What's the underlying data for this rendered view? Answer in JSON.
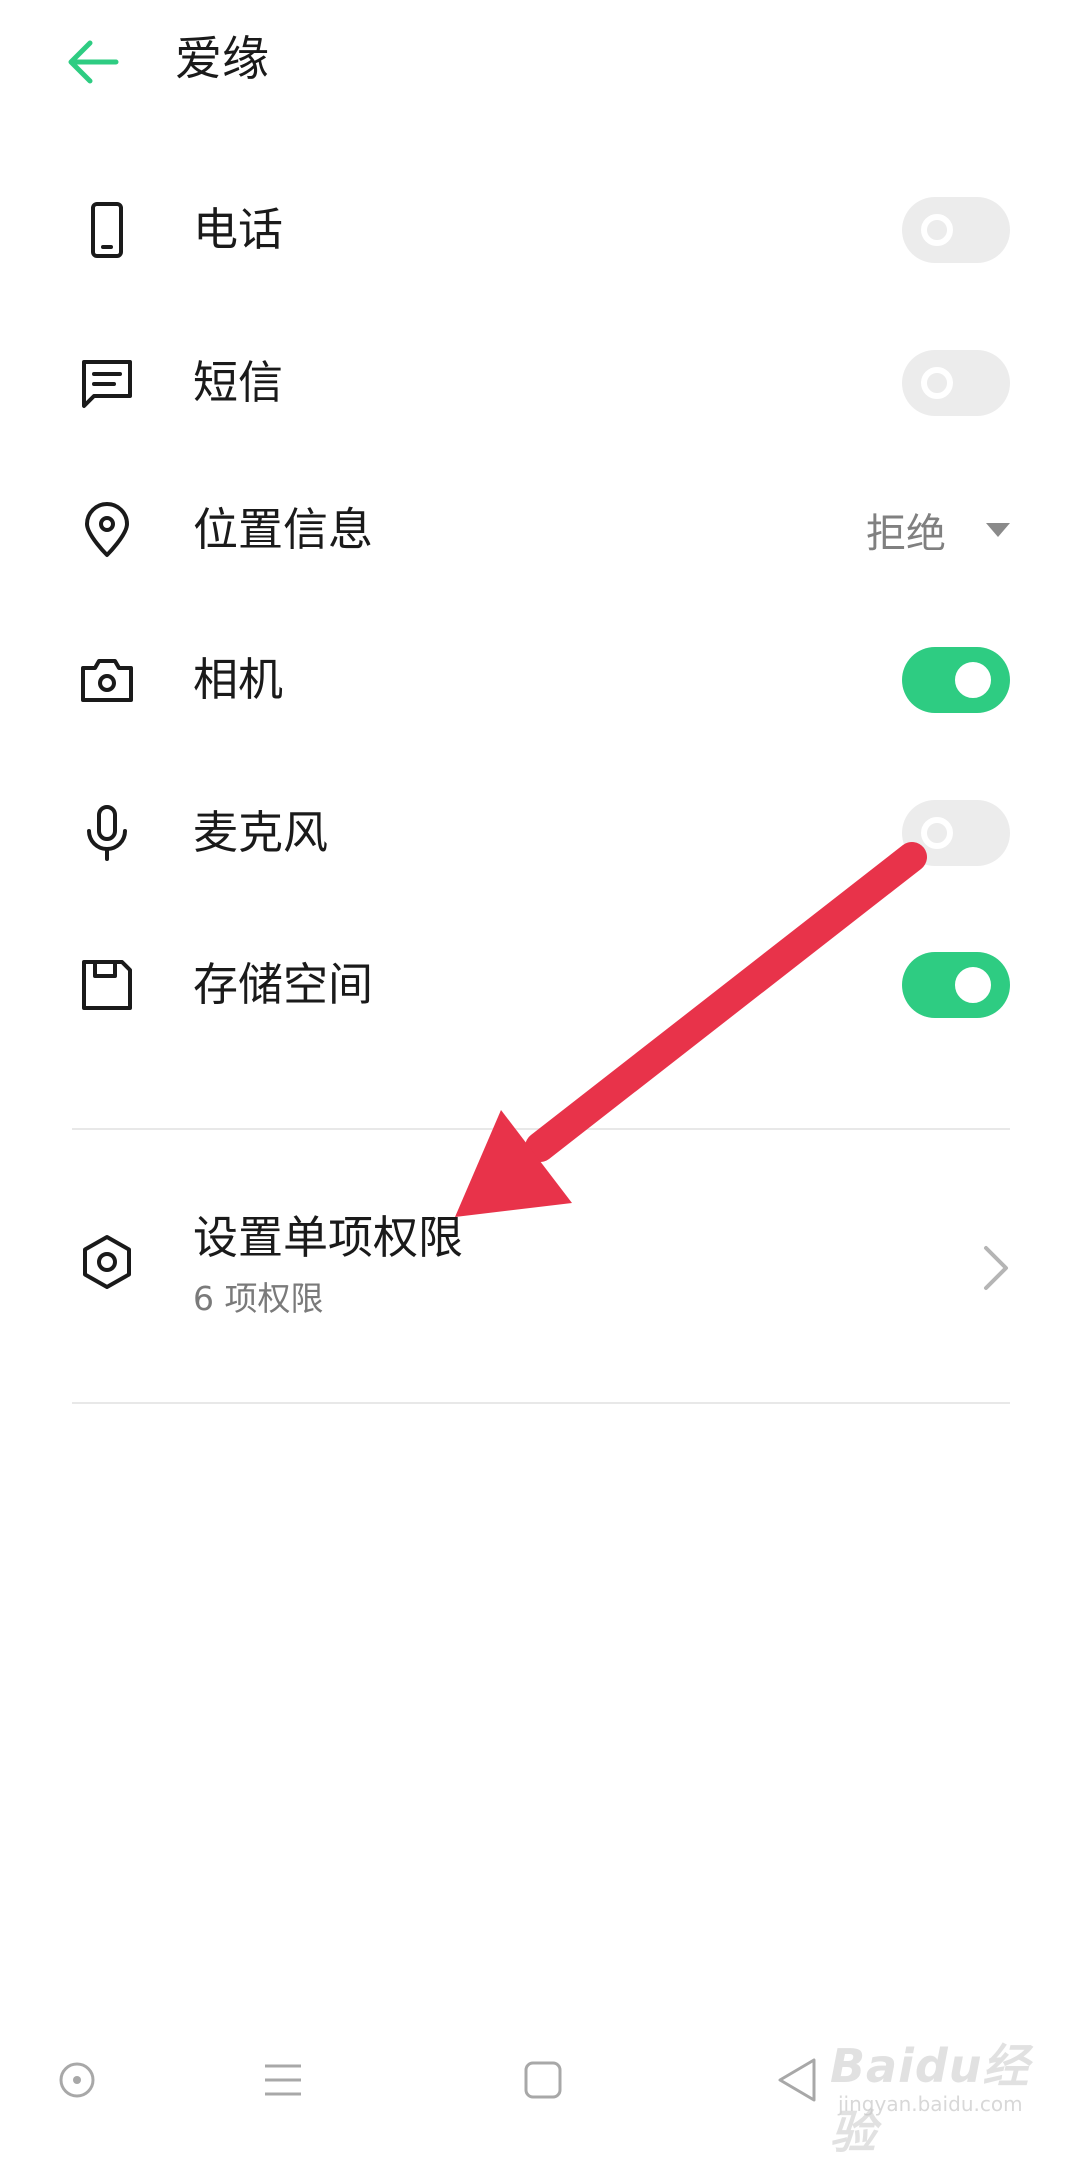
{
  "header": {
    "title": "爱缘"
  },
  "permissions": [
    {
      "label": "电话",
      "icon": "phone-icon",
      "control": "toggle",
      "enabled": false
    },
    {
      "label": "短信",
      "icon": "message-icon",
      "control": "toggle",
      "enabled": false
    },
    {
      "label": "位置信息",
      "icon": "location-pin-icon",
      "control": "dropdown",
      "value": "拒绝"
    },
    {
      "label": "相机",
      "icon": "camera-icon",
      "control": "toggle",
      "enabled": true
    },
    {
      "label": "麦克风",
      "icon": "microphone-icon",
      "control": "toggle",
      "enabled": false
    },
    {
      "label": "存储空间",
      "icon": "storage-icon",
      "control": "toggle",
      "enabled": true
    }
  ],
  "single_permission": {
    "title": "设置单项权限",
    "subtitle": "6 项权限",
    "icon": "hexagon-settings-icon"
  },
  "watermark": {
    "line1": "Baidu经验",
    "line2": "jingyan.baidu.com"
  },
  "colors": {
    "accent": "#2ecc82",
    "toggle_off": "#ececec",
    "annotation_arrow": "#e8334a"
  }
}
